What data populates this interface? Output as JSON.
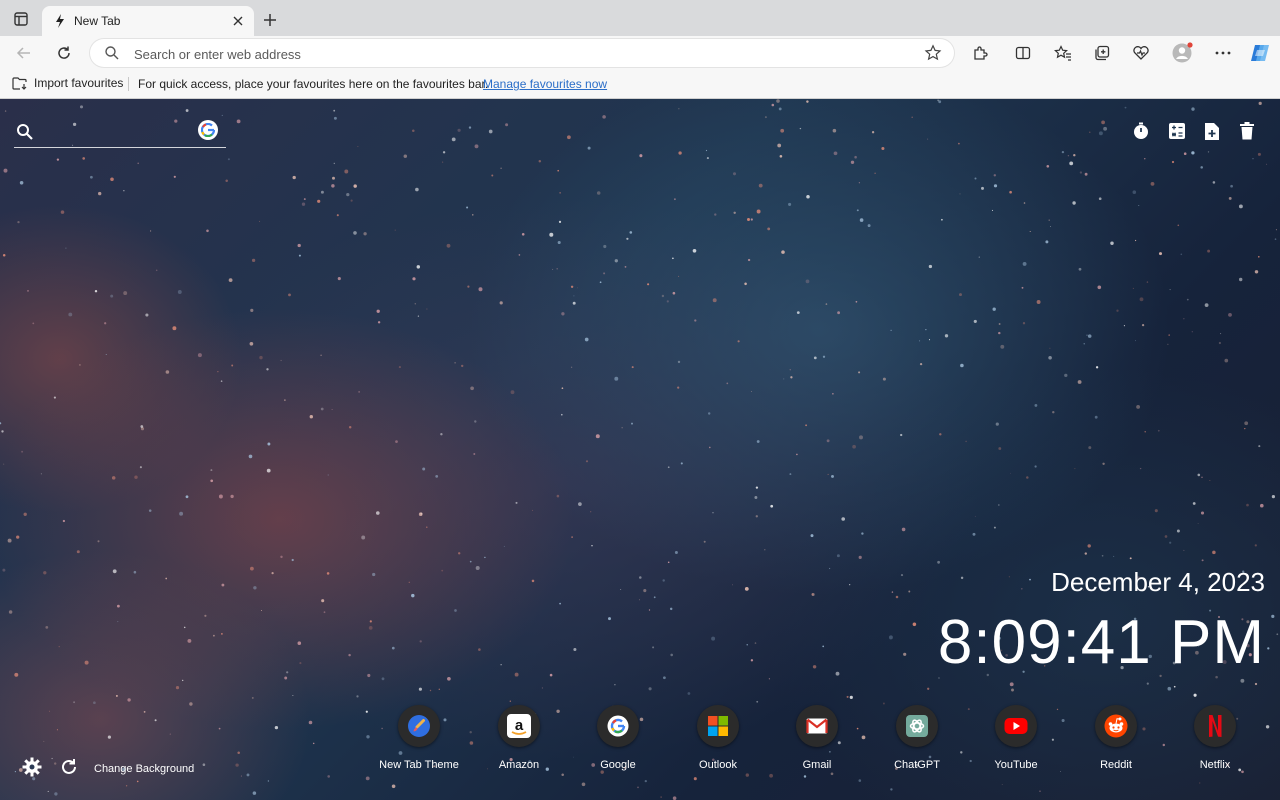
{
  "tab": {
    "title": "New Tab"
  },
  "address": {
    "placeholder": "Search or enter web address"
  },
  "favbar": {
    "import_label": "Import favourites",
    "message": "For quick access, place your favourites here on the favourites bar.",
    "link": "Manage favourites now"
  },
  "newtab": {
    "date": "December 4, 2023",
    "time": "8:09:41 PM",
    "change_background": "Change Background",
    "shortcuts": [
      {
        "label": "New Tab Theme",
        "icon": "paintbrush-icon"
      },
      {
        "label": "Amazon",
        "icon": "amazon-icon"
      },
      {
        "label": "Google",
        "icon": "google-icon"
      },
      {
        "label": "Outlook",
        "icon": "microsoft-icon"
      },
      {
        "label": "Gmail",
        "icon": "gmail-icon"
      },
      {
        "label": "ChatGPT",
        "icon": "chatgpt-icon"
      },
      {
        "label": "YouTube",
        "icon": "youtube-icon"
      },
      {
        "label": "Reddit",
        "icon": "reddit-icon"
      },
      {
        "label": "Netflix",
        "icon": "netflix-icon"
      }
    ]
  },
  "colors": {
    "link": "#2b6ec8",
    "profile_badge": "#e0453a",
    "copilot": "#2a7bd8"
  }
}
